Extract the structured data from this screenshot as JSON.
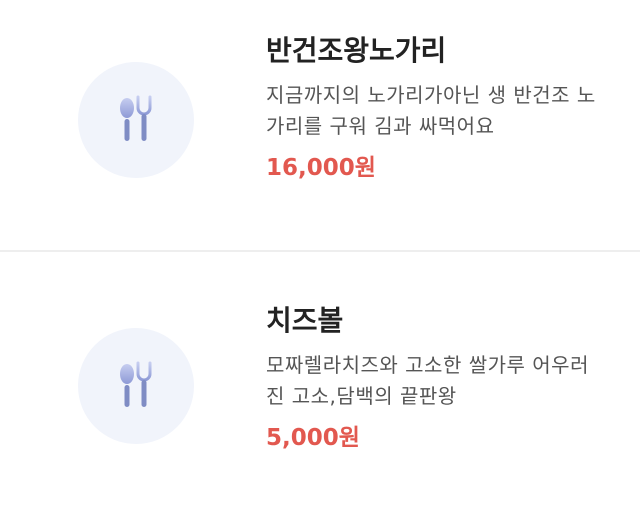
{
  "menu": {
    "items": [
      {
        "name": "반건조왕노가리",
        "description": "지금까지의 노가리가아닌 생 반건조 노가리를 구워 김과 싸먹어요",
        "price": "16,000원",
        "image_icon": "fork-spoon-icon"
      },
      {
        "name": "치즈볼",
        "description": "모짜렐라치즈와 고소한 쌀가루 어우러진 고소,담백의 끝판왕",
        "price": "5,000원",
        "image_icon": "fork-spoon-icon"
      }
    ]
  },
  "colors": {
    "price": "#e2584f",
    "icon_blue": "#7f8cc4",
    "thumb_bg": "#f1f4fb"
  }
}
